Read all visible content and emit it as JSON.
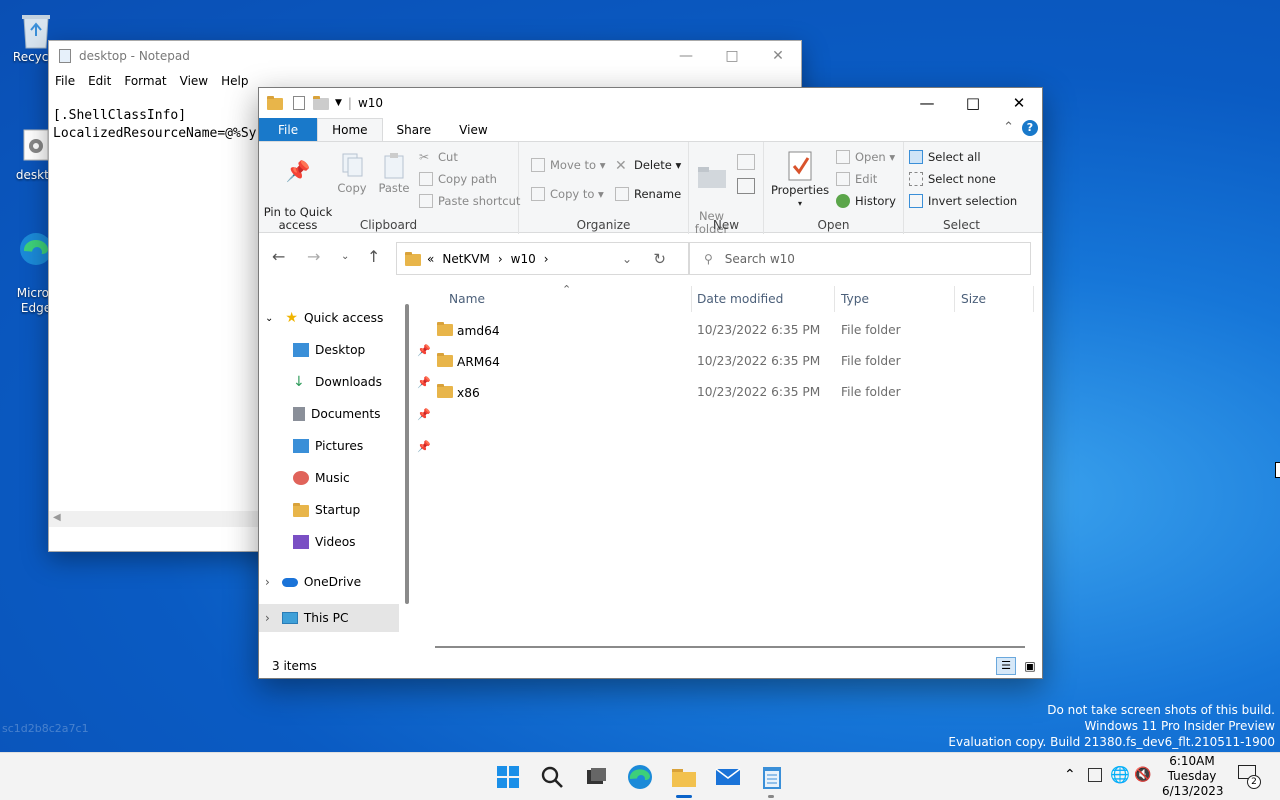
{
  "desktop": {
    "icons": [
      {
        "label": "Recycle"
      },
      {
        "label": "deskto"
      },
      {
        "label": "Micros\nEdge"
      }
    ],
    "faint_text": "sc1d2b8c2a7c1",
    "watermark": [
      "Do not take screen shots of this build.",
      "Windows 11 Pro Insider Preview",
      "Evaluation copy. Build 21380.fs_dev6_flt.210511-1900"
    ]
  },
  "notepad": {
    "title": "desktop - Notepad",
    "menu": [
      "File",
      "Edit",
      "Format",
      "View",
      "Help"
    ],
    "lines": [
      "[.ShellClassInfo]",
      "LocalizedResourceName=@%Sy"
    ]
  },
  "explorer": {
    "title": "w10",
    "tabs": [
      "File",
      "Home",
      "Share",
      "View"
    ],
    "ribbon": {
      "clipboard": {
        "label": "Clipboard",
        "pin": "Pin to Quick\naccess",
        "copy": "Copy",
        "paste": "Paste",
        "cut": "Cut",
        "copy_path": "Copy path",
        "paste_shortcut": "Paste shortcut"
      },
      "organize": {
        "label": "Organize",
        "move_to": "Move to",
        "copy_to": "Copy to",
        "delete": "Delete",
        "rename": "Rename"
      },
      "new": {
        "label": "New",
        "new_folder": "New\nfolder"
      },
      "open": {
        "label": "Open",
        "properties": "Properties",
        "open": "Open",
        "edit": "Edit",
        "history": "History"
      },
      "select": {
        "label": "Select",
        "select_all": "Select all",
        "select_none": "Select none",
        "invert": "Invert selection"
      }
    },
    "address": {
      "prefix": "«",
      "crumbs": [
        "NetKVM",
        "w10"
      ]
    },
    "search_placeholder": "Search w10",
    "nav": {
      "quick_access": "Quick access",
      "items": [
        {
          "label": "Desktop",
          "icon": "desktop-icon",
          "color": "#3a8fd8",
          "pinned": true
        },
        {
          "label": "Downloads",
          "icon": "download-icon",
          "color": "#2e9b5a",
          "pinned": true
        },
        {
          "label": "Documents",
          "icon": "documents-icon",
          "color": "#8a8f99",
          "pinned": true
        },
        {
          "label": "Pictures",
          "icon": "pictures-icon",
          "color": "#3a8fd8",
          "pinned": true
        },
        {
          "label": "Music",
          "icon": "music-icon",
          "color": "#e0635a",
          "pinned": false
        },
        {
          "label": "Startup",
          "icon": "folder-icon",
          "color": "#e8b54a",
          "pinned": false
        },
        {
          "label": "Videos",
          "icon": "videos-icon",
          "color": "#7a4fc4",
          "pinned": false
        }
      ],
      "onedrive": "OneDrive",
      "this_pc": "This PC"
    },
    "columns": [
      "Name",
      "Date modified",
      "Type",
      "Size"
    ],
    "files": [
      {
        "name": "amd64",
        "date": "10/23/2022 6:35 PM",
        "type": "File folder",
        "size": ""
      },
      {
        "name": "ARM64",
        "date": "10/23/2022 6:35 PM",
        "type": "File folder",
        "size": ""
      },
      {
        "name": "x86",
        "date": "10/23/2022 6:35 PM",
        "type": "File folder",
        "size": ""
      }
    ],
    "status": "3 items"
  },
  "taskbar": {
    "time": "6:10AM",
    "day": "Tuesday",
    "date": "6/13/2023",
    "notifications": "2"
  }
}
